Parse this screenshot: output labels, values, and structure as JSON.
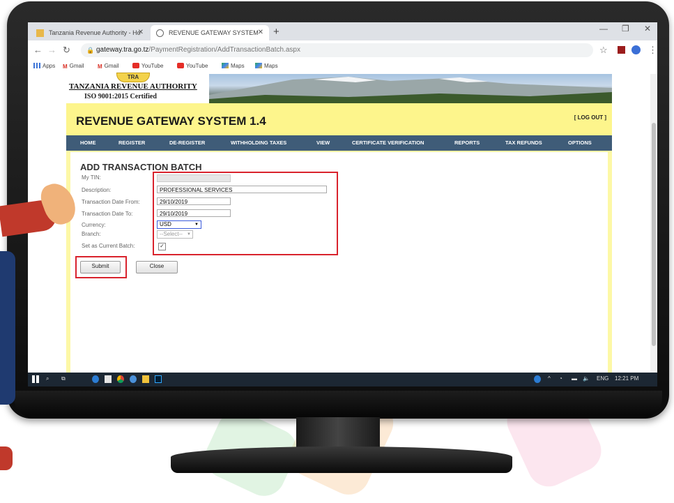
{
  "browser": {
    "tabs": [
      {
        "label": "Tanzania Revenue Authority - Ho",
        "active": false
      },
      {
        "label": "REVENUE GATEWAY SYSTEM",
        "active": true
      }
    ],
    "url_host": "gateway.tra.go.tz",
    "url_path": "/PaymentRegistration/AddTransactionBatch.aspx",
    "bookmarks": [
      {
        "label": "Apps",
        "icon": "apps-grid-icon"
      },
      {
        "label": "Gmail",
        "icon": "gmail-icon"
      },
      {
        "label": "Gmail",
        "icon": "gmail-icon"
      },
      {
        "label": "YouTube",
        "icon": "youtube-icon"
      },
      {
        "label": "YouTube",
        "icon": "youtube-icon"
      },
      {
        "label": "Maps",
        "icon": "maps-icon"
      },
      {
        "label": "Maps",
        "icon": "maps-icon"
      }
    ]
  },
  "header": {
    "logo_text": "TRA",
    "org_name": "TANZANIA REVENUE AUTHORITY",
    "iso": "ISO 9001:2015 Certified",
    "system_title": "REVENUE GATEWAY SYSTEM 1.4",
    "logout": "[ LOG OUT ]"
  },
  "menu": [
    "HOME",
    "REGISTER",
    "DE-REGISTER",
    "WITHHOLDING TAXES",
    "VIEW",
    "CERTIFICATE VERIFICATION",
    "REPORTS",
    "TAX REFUNDS",
    "OPTIONS"
  ],
  "form": {
    "title": "ADD TRANSACTION BATCH",
    "labels": {
      "tin": "My TIN:",
      "description": "Description:",
      "date_from": "Transaction Date From:",
      "date_to": "Transaction Date To:",
      "currency": "Currency:",
      "branch": "Branch:",
      "current_batch": "Set as Current Batch:"
    },
    "values": {
      "tin": "",
      "description": "PROFESSIONAL SERVICES",
      "date_from": "29/10/2019",
      "date_to": "29/10/2019",
      "currency": "USD",
      "branch": "--Select--",
      "current_batch_checked": true
    },
    "submit": "Submit",
    "close": "Close"
  },
  "taskbar": {
    "language": "ENG",
    "time": "12:21 PM"
  },
  "colors": {
    "menu_bg": "#3f5c78",
    "page_bg": "#fdf8a6",
    "highlight": "#d9232d"
  }
}
